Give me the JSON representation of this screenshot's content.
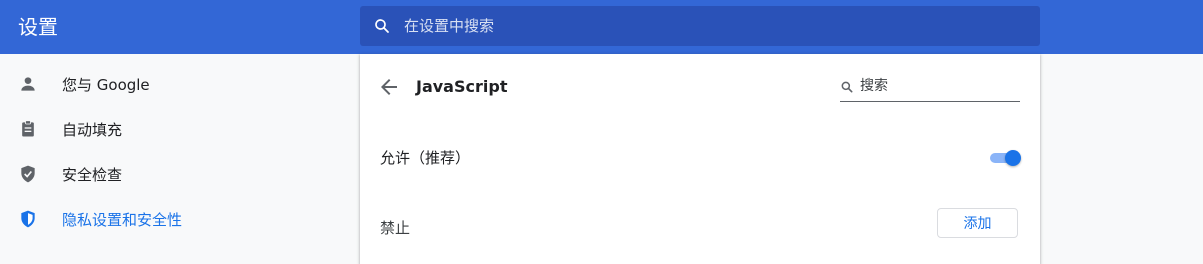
{
  "app": {
    "title": "设置"
  },
  "search": {
    "placeholder": "在设置中搜索",
    "icon": "search-icon"
  },
  "sidebar": {
    "items": [
      {
        "label": "您与 Google",
        "icon": "person-icon"
      },
      {
        "label": "自动填充",
        "icon": "clipboard-icon"
      },
      {
        "label": "安全检查",
        "icon": "shield-check-icon"
      },
      {
        "label": "隐私设置和安全性",
        "icon": "shield-half-icon",
        "active": true
      }
    ]
  },
  "panel": {
    "title": "JavaScript",
    "back_icon": "back-arrow-icon",
    "search_placeholder": "搜索",
    "allow_label": "允许（推荐）",
    "allow_enabled": true,
    "block_label": "禁止",
    "add_button": "添加"
  },
  "colors": {
    "header": "#3367d6",
    "search_bg": "#2a52b8",
    "accent": "#1a73e8",
    "toggle_track": "#8ab4f8"
  }
}
